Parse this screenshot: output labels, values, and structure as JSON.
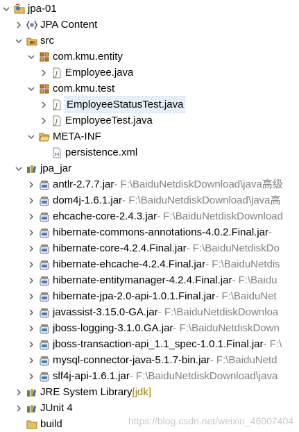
{
  "project": {
    "label": "jpa-01"
  },
  "jpa_content": {
    "label": "JPA Content"
  },
  "src": {
    "label": "src"
  },
  "pkg_entity": {
    "label": "com.kmu.entity"
  },
  "employee_java": {
    "label": "Employee.java"
  },
  "pkg_test": {
    "label": "com.kmu.test"
  },
  "status_test": {
    "label": "EmployeeStatusTest.java"
  },
  "employee_test": {
    "label": "EmployeeTest.java"
  },
  "meta_inf": {
    "label": "META-INF"
  },
  "persistence": {
    "label": "persistence.xml"
  },
  "jpa_jar": {
    "label": "jpa_jar"
  },
  "jars": [
    {
      "name": "antlr-2.7.7.jar",
      "loc": " - F:\\BaiduNetdiskDownload\\java高级"
    },
    {
      "name": "dom4j-1.6.1.jar",
      "loc": " - F:\\BaiduNetdiskDownload\\java高"
    },
    {
      "name": "ehcache-core-2.4.3.jar",
      "loc": " - F:\\BaiduNetdiskDownload"
    },
    {
      "name": "hibernate-commons-annotations-4.0.2.Final.jar",
      "loc": " - "
    },
    {
      "name": "hibernate-core-4.2.4.Final.jar",
      "loc": " - F:\\BaiduNetdiskDo"
    },
    {
      "name": "hibernate-ehcache-4.2.4.Final.jar",
      "loc": " - F:\\BaiduNetdis"
    },
    {
      "name": "hibernate-entitymanager-4.2.4.Final.jar",
      "loc": " - F:\\Baidu"
    },
    {
      "name": "hibernate-jpa-2.0-api-1.0.1.Final.jar",
      "loc": " - F:\\BaiduNet"
    },
    {
      "name": "javassist-3.15.0-GA.jar",
      "loc": " - F:\\BaiduNetdiskDownloa"
    },
    {
      "name": "jboss-logging-3.1.0.GA.jar",
      "loc": " - F:\\BaiduNetdiskDown"
    },
    {
      "name": "jboss-transaction-api_1.1_spec-1.0.1.Final.jar",
      "loc": " - F:\\"
    },
    {
      "name": "mysql-connector-java-5.1.7-bin.jar",
      "loc": " - F:\\BaiduNetd"
    },
    {
      "name": "slf4j-api-1.6.1.jar",
      "loc": " - F:\\BaiduNetdiskDownload\\java"
    }
  ],
  "jre": {
    "label": "JRE System Library ",
    "deco": "[jdk]"
  },
  "junit": {
    "label": "JUnit 4"
  },
  "build": {
    "label": "build"
  },
  "watermark": "https://blog.csdn.net/weixin_46007404"
}
